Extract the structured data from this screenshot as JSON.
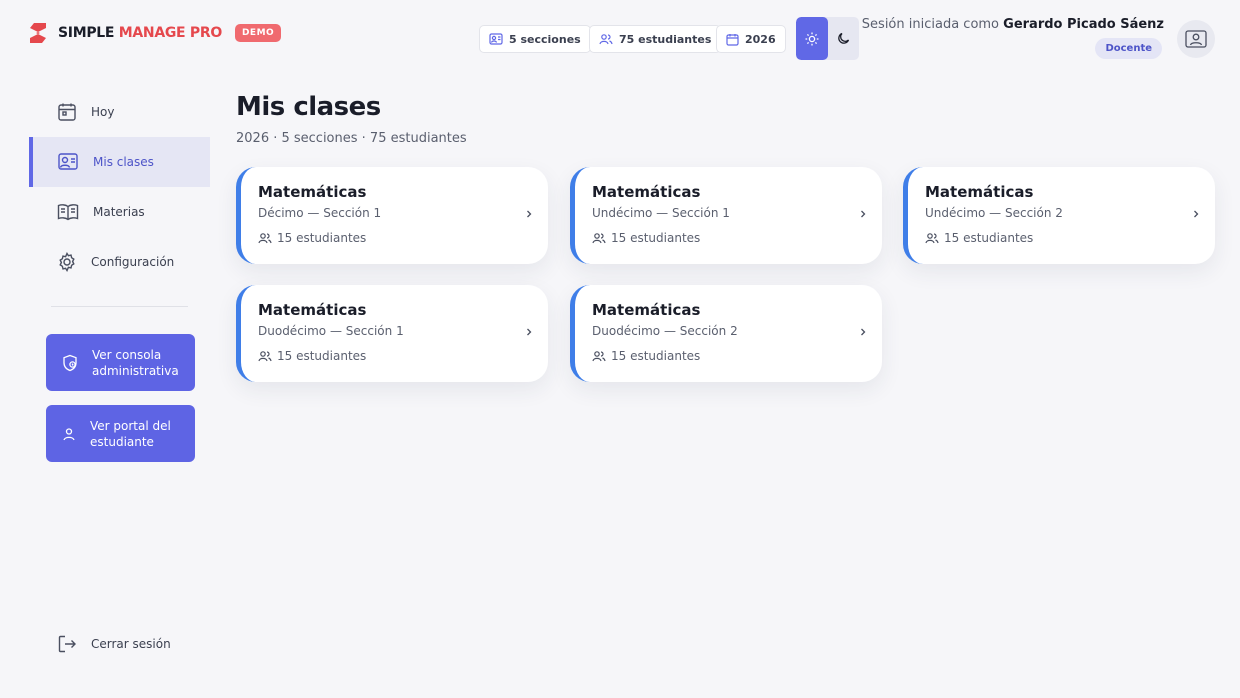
{
  "brand": {
    "name_part1": "SIMPLE ",
    "name_part2": "MANAGE PRO",
    "badge": "DEMO"
  },
  "header": {
    "chips": [
      {
        "label": "5 secciones",
        "icon": "sections-icon"
      },
      {
        "label": "75 estudiantes",
        "icon": "users-icon"
      },
      {
        "label": "2026",
        "icon": "calendar-icon"
      }
    ],
    "theme": {
      "active": "light"
    },
    "session": {
      "prefix": "Sesión iniciada como ",
      "user": "Gerardo Picado Sáenz",
      "role": "Docente"
    }
  },
  "sidebar": {
    "items": [
      {
        "label": "Hoy",
        "icon": "calendar-icon",
        "active": false
      },
      {
        "label": "Mis clases",
        "icon": "class-icon",
        "active": true
      },
      {
        "label": "Materias",
        "icon": "book-icon",
        "active": false
      },
      {
        "label": "Configuración",
        "icon": "gear-icon",
        "active": false
      }
    ],
    "actions": [
      {
        "label": "Ver consola administrativa",
        "icon": "shield-user-icon"
      },
      {
        "label": "Ver portal del estudiante",
        "icon": "user-icon"
      }
    ],
    "logout": "Cerrar sesión"
  },
  "main": {
    "title": "Mis clases",
    "subtitle": "2026 · 5 secciones · 75 estudiantes",
    "cards": [
      {
        "subject": "Matemáticas",
        "section": "Décimo — Sección 1",
        "count": "15 estudiantes"
      },
      {
        "subject": "Matemáticas",
        "section": "Undécimo — Sección 1",
        "count": "15 estudiantes"
      },
      {
        "subject": "Matemáticas",
        "section": "Undécimo — Sección 2",
        "count": "15 estudiantes"
      },
      {
        "subject": "Matemáticas",
        "section": "Duodécimo — Sección 1",
        "count": "15 estudiantes"
      },
      {
        "subject": "Matemáticas",
        "section": "Duodécimo — Sección 2",
        "count": "15 estudiantes"
      }
    ]
  },
  "colors": {
    "accent": "#6068e6",
    "card_border": "#3f7ee8",
    "brand_red": "#e5484d"
  }
}
